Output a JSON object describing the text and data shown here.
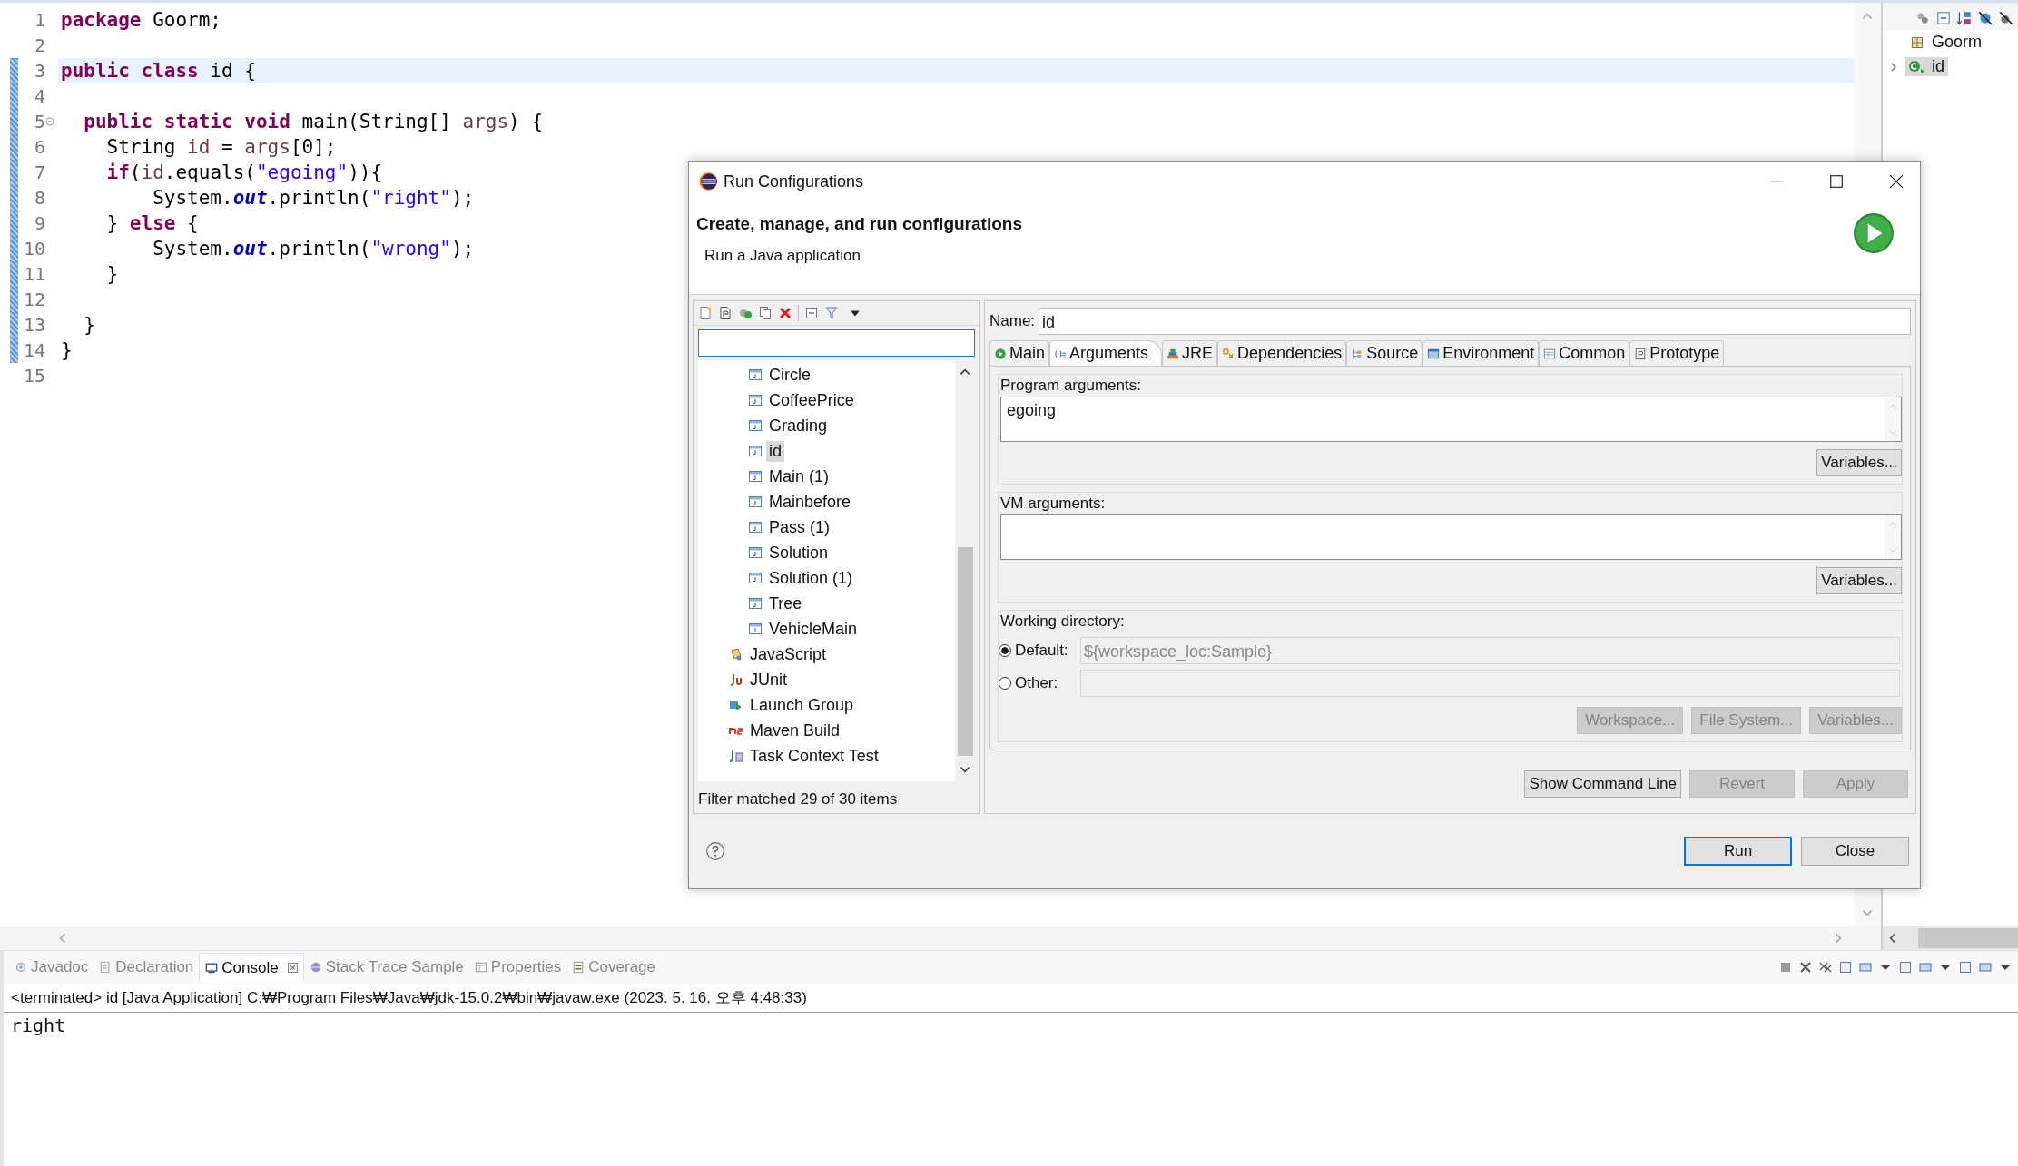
{
  "editor": {
    "lines": [
      {
        "number": "1",
        "current": false,
        "fold": false,
        "in_range": false,
        "tokens": [
          {
            "text": "package",
            "kind": "keyword"
          },
          {
            "text": " Goorm;",
            "kind": "plain"
          }
        ]
      },
      {
        "number": "2",
        "current": false,
        "fold": false,
        "in_range": false
      },
      {
        "number": "3",
        "current": true,
        "fold": false,
        "in_range": true,
        "tokens": [
          {
            "text": "public class",
            "kind": "keyword"
          },
          {
            "text": " id {",
            "kind": "plain"
          }
        ]
      },
      {
        "number": "4",
        "current": false,
        "fold": false,
        "in_range": true
      },
      {
        "number": "5",
        "current": false,
        "fold": true,
        "in_range": true,
        "tokens": [
          {
            "text": "  public static void",
            "kind": "keyword"
          },
          {
            "text": " main(String[] ",
            "kind": "plain"
          },
          {
            "text": "args",
            "kind": "variable"
          },
          {
            "text": ") {",
            "kind": "plain"
          }
        ]
      },
      {
        "number": "6",
        "current": false,
        "fold": false,
        "in_range": true,
        "tokens": [
          {
            "text": "    String ",
            "kind": "plain"
          },
          {
            "text": "id",
            "kind": "variable"
          },
          {
            "text": " = ",
            "kind": "plain"
          },
          {
            "text": "args",
            "kind": "variable"
          },
          {
            "text": "[0];",
            "kind": "plain"
          }
        ]
      },
      {
        "number": "7",
        "current": false,
        "fold": false,
        "in_range": true,
        "tokens": [
          {
            "text": "    if",
            "kind": "keyword"
          },
          {
            "text": "(",
            "kind": "plain"
          },
          {
            "text": "id",
            "kind": "variable"
          },
          {
            "text": ".equals(",
            "kind": "plain"
          },
          {
            "text": "\"egoing\"",
            "kind": "string"
          },
          {
            "text": ")){",
            "kind": "plain"
          }
        ]
      },
      {
        "number": "8",
        "current": false,
        "fold": false,
        "in_range": true,
        "tokens": [
          {
            "text": "        System.",
            "kind": "plain"
          },
          {
            "text": "out",
            "kind": "field"
          },
          {
            "text": ".println(",
            "kind": "plain"
          },
          {
            "text": "\"right\"",
            "kind": "string"
          },
          {
            "text": ");",
            "kind": "plain"
          }
        ]
      },
      {
        "number": "9",
        "current": false,
        "fold": false,
        "in_range": true,
        "tokens": [
          {
            "text": "    } ",
            "kind": "plain"
          },
          {
            "text": "else",
            "kind": "keyword"
          },
          {
            "text": " {",
            "kind": "plain"
          }
        ]
      },
      {
        "number": "10",
        "current": false,
        "fold": false,
        "in_range": true,
        "tokens": [
          {
            "text": "        System.",
            "kind": "plain"
          },
          {
            "text": "out",
            "kind": "field"
          },
          {
            "text": ".println(",
            "kind": "plain"
          },
          {
            "text": "\"wrong\"",
            "kind": "string"
          },
          {
            "text": ");",
            "kind": "plain"
          }
        ]
      },
      {
        "number": "11",
        "current": false,
        "fold": false,
        "in_range": true,
        "tokens": [
          {
            "text": "    }",
            "kind": "plain"
          }
        ]
      },
      {
        "number": "12",
        "current": false,
        "fold": false,
        "in_range": true
      },
      {
        "number": "13",
        "current": false,
        "fold": false,
        "in_range": true,
        "tokens": [
          {
            "text": "  }",
            "kind": "plain"
          }
        ]
      },
      {
        "number": "14",
        "current": false,
        "fold": false,
        "in_range": true,
        "tokens": [
          {
            "text": "}",
            "kind": "plain"
          }
        ]
      },
      {
        "number": "15",
        "current": false,
        "fold": false,
        "in_range": false
      }
    ]
  },
  "outline": {
    "items": [
      {
        "label": "Goorm",
        "kind": "package",
        "selected": false,
        "expandable": false
      },
      {
        "label": "id",
        "kind": "class",
        "selected": true,
        "expandable": true
      }
    ]
  },
  "dialog": {
    "title": "Run Configurations",
    "heading": "Create, manage, and run configurations",
    "subtitle": "Run a Java application",
    "tree": [
      {
        "children": [
          {
            "label": "Circle",
            "kind": "java",
            "selected": false
          },
          {
            "label": "CoffeePrice",
            "kind": "java",
            "selected": false
          },
          {
            "label": "Grading",
            "kind": "java",
            "selected": false
          },
          {
            "label": "id",
            "kind": "java",
            "selected": true
          },
          {
            "label": "Main (1)",
            "kind": "java",
            "selected": false
          },
          {
            "label": "Mainbefore",
            "kind": "java",
            "selected": false
          },
          {
            "label": "Pass (1)",
            "kind": "java",
            "selected": false
          },
          {
            "label": "Solution",
            "kind": "java",
            "selected": false
          },
          {
            "label": "Solution (1)",
            "kind": "java",
            "selected": false
          },
          {
            "label": "Tree",
            "kind": "java",
            "selected": false
          },
          {
            "label": "VehicleMain",
            "kind": "java",
            "selected": false
          }
        ]
      },
      {
        "label": "JavaScript",
        "kind": "javascript",
        "selected": false
      },
      {
        "label": "JUnit",
        "kind": "junit",
        "selected": false
      },
      {
        "label": "Launch Group",
        "kind": "launch_group",
        "selected": false
      },
      {
        "label": "Maven Build",
        "kind": "maven",
        "selected": false
      },
      {
        "label": "Task Context Test",
        "kind": "task_test",
        "selected": false
      }
    ],
    "filter_status": "Filter matched 29 of 30 items",
    "name_label": "Name:",
    "name_value": "id",
    "tabs": [
      {
        "label": "Main",
        "kind": "main",
        "selected": false
      },
      {
        "label": "Arguments",
        "kind": "arguments",
        "selected": true
      },
      {
        "label": "JRE",
        "kind": "jre",
        "selected": false
      },
      {
        "label": "Dependencies",
        "kind": "dependencies",
        "selected": false
      },
      {
        "label": "Source",
        "kind": "source",
        "selected": false
      },
      {
        "label": "Environment",
        "kind": "environment",
        "selected": false
      },
      {
        "label": "Common",
        "kind": "common",
        "selected": false
      },
      {
        "label": "Prototype",
        "kind": "prototype",
        "selected": false
      }
    ],
    "program_arguments": {
      "label": "Program arguments:",
      "value": "egoing",
      "button": "Variables..."
    },
    "vm_arguments": {
      "label": "VM arguments:",
      "button": "Variables..."
    },
    "working_directory": {
      "label": "Working directory:",
      "options": [
        {
          "label": "Default:",
          "selected": true,
          "value": "${workspace_loc:Sample}"
        },
        {
          "label": "Other:",
          "selected": false
        }
      ],
      "buttons": [
        {
          "label": "Workspace...",
          "disabled": true
        },
        {
          "label": "File System...",
          "disabled": true
        },
        {
          "label": "Variables...",
          "disabled": true
        }
      ]
    },
    "actions": [
      {
        "label": "Show Command Line",
        "disabled": false
      },
      {
        "label": "Revert",
        "disabled": true
      },
      {
        "label": "Apply",
        "disabled": true
      }
    ],
    "buttons": [
      {
        "label": "Run",
        "default": true
      },
      {
        "label": "Close",
        "default": false
      }
    ]
  },
  "bottom_panel": {
    "tabs": [
      {
        "label": "Javadoc",
        "kind": "javadoc",
        "selected": false
      },
      {
        "label": "Declaration",
        "kind": "declaration",
        "selected": false
      },
      {
        "label": "Console",
        "kind": "console",
        "selected": true
      },
      {
        "label": "Stack Trace Sample",
        "kind": "stack",
        "selected": false
      },
      {
        "label": "Properties",
        "kind": "properties",
        "selected": false
      },
      {
        "label": "Coverage",
        "kind": "coverage",
        "selected": false
      }
    ],
    "console": {
      "header": "<terminated> id [Java Application] C:₩Program Files₩Java₩jdk-15.0.2₩bin₩javaw.exe (2023. 5. 16. 오후 4:48:33)",
      "output": "right"
    }
  }
}
